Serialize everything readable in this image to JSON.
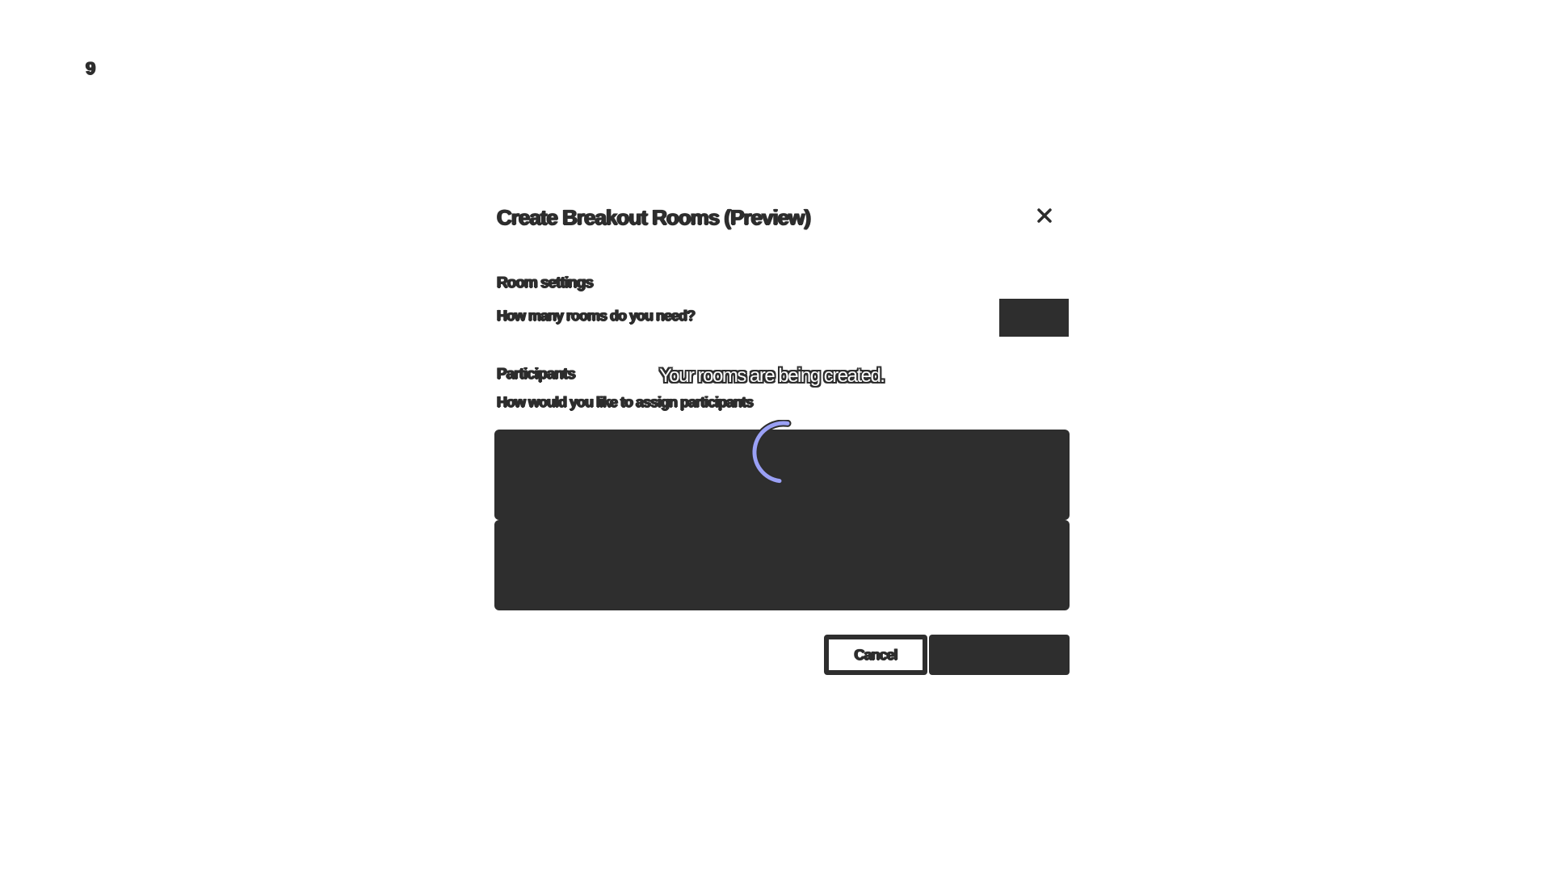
{
  "window": {
    "corner_glyph": "9"
  },
  "dialog": {
    "title": "Create Breakout Rooms (Preview)",
    "close_icon": "close-icon",
    "room_settings": {
      "label": "Room settings",
      "question": "How many rooms do you need?",
      "rooms_count_value": ""
    },
    "participants": {
      "label": "Participants",
      "question": "How would you like to assign participants"
    },
    "assign_options": [
      {
        "label": ""
      },
      {
        "label": ""
      }
    ],
    "loading": {
      "message": "Your rooms are being created.",
      "spinner_icon": "spinner-icon",
      "spinner_color": "#9aa0f5"
    },
    "buttons": {
      "cancel_label": "Cancel",
      "create_label": ""
    }
  }
}
